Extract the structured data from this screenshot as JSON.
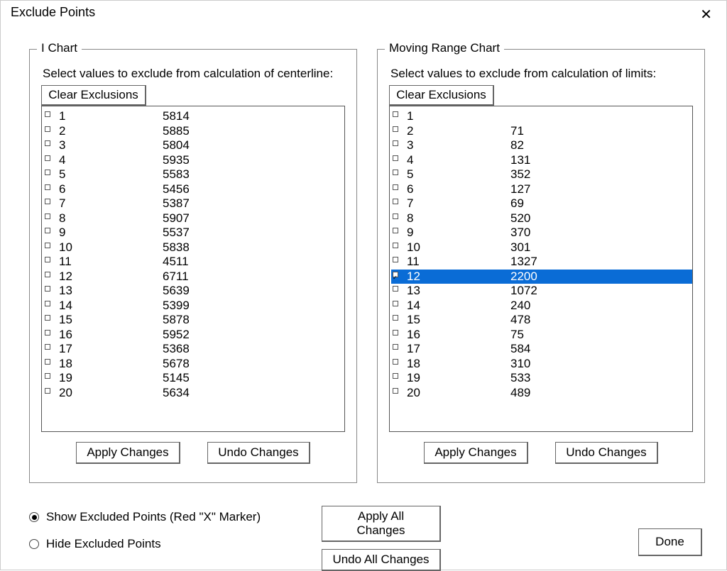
{
  "window": {
    "title": "Exclude Points"
  },
  "i_chart": {
    "legend": "I Chart",
    "hint": "Select values to exclude from calculation of centerline:",
    "clear_label": "Clear Exclusions",
    "apply_label": "Apply Changes",
    "undo_label": "Undo Changes",
    "rows": [
      {
        "idx": "1",
        "val": "5814",
        "selected": false
      },
      {
        "idx": "2",
        "val": "5885",
        "selected": false
      },
      {
        "idx": "3",
        "val": "5804",
        "selected": false
      },
      {
        "idx": "4",
        "val": "5935",
        "selected": false
      },
      {
        "idx": "5",
        "val": "5583",
        "selected": false
      },
      {
        "idx": "6",
        "val": "5456",
        "selected": false
      },
      {
        "idx": "7",
        "val": "5387",
        "selected": false
      },
      {
        "idx": "8",
        "val": "5907",
        "selected": false
      },
      {
        "idx": "9",
        "val": "5537",
        "selected": false
      },
      {
        "idx": "10",
        "val": "5838",
        "selected": false
      },
      {
        "idx": "11",
        "val": "4511",
        "selected": false
      },
      {
        "idx": "12",
        "val": "6711",
        "selected": false
      },
      {
        "idx": "13",
        "val": "5639",
        "selected": false
      },
      {
        "idx": "14",
        "val": "5399",
        "selected": false
      },
      {
        "idx": "15",
        "val": "5878",
        "selected": false
      },
      {
        "idx": "16",
        "val": "5952",
        "selected": false
      },
      {
        "idx": "17",
        "val": "5368",
        "selected": false
      },
      {
        "idx": "18",
        "val": "5678",
        "selected": false
      },
      {
        "idx": "19",
        "val": "5145",
        "selected": false
      },
      {
        "idx": "20",
        "val": "5634",
        "selected": false
      }
    ]
  },
  "mr_chart": {
    "legend": "Moving Range Chart",
    "hint": "Select values to exclude from calculation of limits:",
    "clear_label": "Clear Exclusions",
    "apply_label": "Apply Changes",
    "undo_label": "Undo Changes",
    "rows": [
      {
        "idx": "1",
        "val": "",
        "selected": false
      },
      {
        "idx": "2",
        "val": "71",
        "selected": false
      },
      {
        "idx": "3",
        "val": "82",
        "selected": false
      },
      {
        "idx": "4",
        "val": "131",
        "selected": false
      },
      {
        "idx": "5",
        "val": "352",
        "selected": false
      },
      {
        "idx": "6",
        "val": "127",
        "selected": false
      },
      {
        "idx": "7",
        "val": "69",
        "selected": false
      },
      {
        "idx": "8",
        "val": "520",
        "selected": false
      },
      {
        "idx": "9",
        "val": "370",
        "selected": false
      },
      {
        "idx": "10",
        "val": "301",
        "selected": false
      },
      {
        "idx": "11",
        "val": "1327",
        "selected": false
      },
      {
        "idx": "12",
        "val": "2200",
        "selected": true
      },
      {
        "idx": "13",
        "val": "1072",
        "selected": false
      },
      {
        "idx": "14",
        "val": "240",
        "selected": false
      },
      {
        "idx": "15",
        "val": "478",
        "selected": false
      },
      {
        "idx": "16",
        "val": "75",
        "selected": false
      },
      {
        "idx": "17",
        "val": "584",
        "selected": false
      },
      {
        "idx": "18",
        "val": "310",
        "selected": false
      },
      {
        "idx": "19",
        "val": "533",
        "selected": false
      },
      {
        "idx": "20",
        "val": "489",
        "selected": false
      }
    ]
  },
  "options": {
    "show_label": "Show Excluded Points (Red \"X\" Marker)",
    "hide_label": "Hide Excluded Points",
    "selected": "show"
  },
  "global": {
    "apply_all": "Apply All Changes",
    "undo_all": "Undo All Changes",
    "done": "Done"
  }
}
